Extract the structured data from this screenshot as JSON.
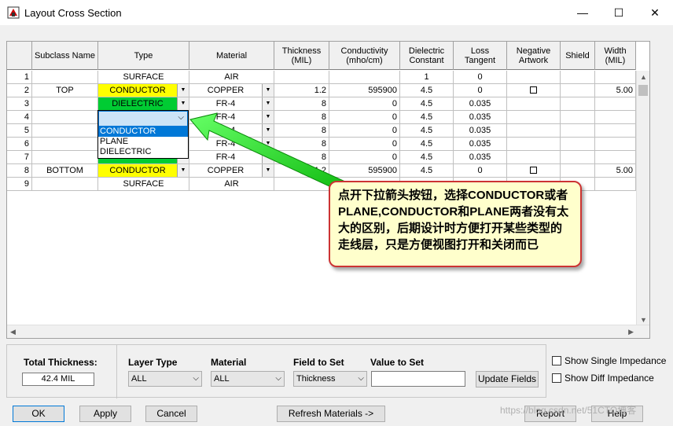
{
  "window": {
    "title": "Layout Cross Section",
    "minimize": "—",
    "maximize": "☐",
    "close": "✕"
  },
  "columns": [
    "",
    "Subclass Name",
    "Type",
    "Material",
    "Thickness (MIL)",
    "Conductivity (mho/cm)",
    "Dielectric Constant",
    "Loss Tangent",
    "Negative Artwork",
    "Shield",
    "Width (MIL)"
  ],
  "rows": [
    {
      "n": "1",
      "name": "",
      "type": "SURFACE",
      "tclass": "",
      "tdd": false,
      "mat": "AIR",
      "mdd": false,
      "thick": "",
      "cond": "",
      "diel": "1",
      "loss": "0",
      "neg": false,
      "width": ""
    },
    {
      "n": "2",
      "name": "TOP",
      "type": "CONDUCTOR",
      "tclass": "cond",
      "tdd": true,
      "mat": "COPPER",
      "mdd": true,
      "thick": "1.2",
      "cond": "595900",
      "diel": "4.5",
      "loss": "0",
      "neg": true,
      "width": "5.00"
    },
    {
      "n": "3",
      "name": "",
      "type": "DIELECTRIC",
      "tclass": "diel",
      "tdd": true,
      "mat": "FR-4",
      "mdd": true,
      "thick": "8",
      "cond": "0",
      "diel": "4.5",
      "loss": "0.035",
      "neg": false,
      "width": ""
    },
    {
      "n": "4",
      "name": "",
      "type": "",
      "tclass": "",
      "tdd": false,
      "mat": "FR-4",
      "mdd": true,
      "thick": "8",
      "cond": "0",
      "diel": "4.5",
      "loss": "0.035",
      "neg": false,
      "width": ""
    },
    {
      "n": "5",
      "name": "",
      "type": "",
      "tclass": "",
      "tdd": false,
      "mat": "FR-4",
      "mdd": true,
      "thick": "8",
      "cond": "0",
      "diel": "4.5",
      "loss": "0.035",
      "neg": false,
      "width": ""
    },
    {
      "n": "6",
      "name": "",
      "type": "",
      "tclass": "",
      "tdd": false,
      "mat": "FR-4",
      "mdd": true,
      "thick": "8",
      "cond": "0",
      "diel": "4.5",
      "loss": "0.035",
      "neg": false,
      "width": ""
    },
    {
      "n": "7",
      "name": "",
      "type": "",
      "tclass": "diel",
      "tdd": true,
      "mat": "FR-4",
      "mdd": true,
      "thick": "8",
      "cond": "0",
      "diel": "4.5",
      "loss": "0.035",
      "neg": false,
      "width": ""
    },
    {
      "n": "8",
      "name": "BOTTOM",
      "type": "CONDUCTOR",
      "tclass": "cond",
      "tdd": true,
      "mat": "COPPER",
      "mdd": true,
      "thick": "1.2",
      "cond": "595900",
      "diel": "4.5",
      "loss": "0",
      "neg": true,
      "width": "5.00"
    },
    {
      "n": "9",
      "name": "",
      "type": "SURFACE",
      "tclass": "",
      "tdd": false,
      "mat": "AIR",
      "mdd": false,
      "thick": "",
      "cond": "",
      "diel": "",
      "loss": "",
      "neg": false,
      "width": ""
    }
  ],
  "dropdown": {
    "options": [
      "CONDUCTOR",
      "PLANE",
      "DIELECTRIC"
    ],
    "selected": "CONDUCTOR"
  },
  "callout": "点开下拉箭头按钮，选择CONDUCTOR或者PLANE,CONDUCTOR和PLANE两者没有太大的区别，后期设计时方便打开某些类型的走线层，只是方便视图打开和关闭而已",
  "bottom": {
    "total_label": "Total Thickness:",
    "total_value": "42.4 MIL",
    "layer_type_label": "Layer Type",
    "layer_type_value": "ALL",
    "material_label": "Material",
    "material_value": "ALL",
    "field_label": "Field to Set",
    "field_value": "Thickness",
    "value_label": "Value to Set",
    "update_btn": "Update Fields",
    "show_single": "Show Single Impedance",
    "show_diff": "Show Diff Impedance"
  },
  "buttons": {
    "ok": "OK",
    "apply": "Apply",
    "cancel": "Cancel",
    "refresh": "Refresh Materials ->",
    "report": "Report",
    "help": "Help"
  },
  "watermark": "https://blog.csdn.net/51CTO博客"
}
